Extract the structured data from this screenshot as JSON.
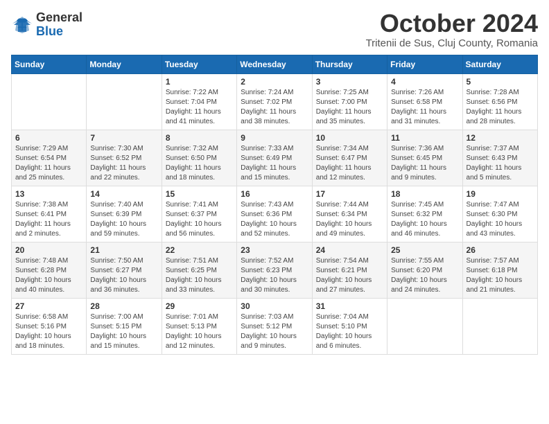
{
  "header": {
    "logo_general": "General",
    "logo_blue": "Blue",
    "month_title": "October 2024",
    "location": "Tritenii de Sus, Cluj County, Romania"
  },
  "days_of_week": [
    "Sunday",
    "Monday",
    "Tuesday",
    "Wednesday",
    "Thursday",
    "Friday",
    "Saturday"
  ],
  "weeks": [
    [
      {
        "day": "",
        "info": ""
      },
      {
        "day": "",
        "info": ""
      },
      {
        "day": "1",
        "info": "Sunrise: 7:22 AM\nSunset: 7:04 PM\nDaylight: 11 hours and 41 minutes."
      },
      {
        "day": "2",
        "info": "Sunrise: 7:24 AM\nSunset: 7:02 PM\nDaylight: 11 hours and 38 minutes."
      },
      {
        "day": "3",
        "info": "Sunrise: 7:25 AM\nSunset: 7:00 PM\nDaylight: 11 hours and 35 minutes."
      },
      {
        "day": "4",
        "info": "Sunrise: 7:26 AM\nSunset: 6:58 PM\nDaylight: 11 hours and 31 minutes."
      },
      {
        "day": "5",
        "info": "Sunrise: 7:28 AM\nSunset: 6:56 PM\nDaylight: 11 hours and 28 minutes."
      }
    ],
    [
      {
        "day": "6",
        "info": "Sunrise: 7:29 AM\nSunset: 6:54 PM\nDaylight: 11 hours and 25 minutes."
      },
      {
        "day": "7",
        "info": "Sunrise: 7:30 AM\nSunset: 6:52 PM\nDaylight: 11 hours and 22 minutes."
      },
      {
        "day": "8",
        "info": "Sunrise: 7:32 AM\nSunset: 6:50 PM\nDaylight: 11 hours and 18 minutes."
      },
      {
        "day": "9",
        "info": "Sunrise: 7:33 AM\nSunset: 6:49 PM\nDaylight: 11 hours and 15 minutes."
      },
      {
        "day": "10",
        "info": "Sunrise: 7:34 AM\nSunset: 6:47 PM\nDaylight: 11 hours and 12 minutes."
      },
      {
        "day": "11",
        "info": "Sunrise: 7:36 AM\nSunset: 6:45 PM\nDaylight: 11 hours and 9 minutes."
      },
      {
        "day": "12",
        "info": "Sunrise: 7:37 AM\nSunset: 6:43 PM\nDaylight: 11 hours and 5 minutes."
      }
    ],
    [
      {
        "day": "13",
        "info": "Sunrise: 7:38 AM\nSunset: 6:41 PM\nDaylight: 11 hours and 2 minutes."
      },
      {
        "day": "14",
        "info": "Sunrise: 7:40 AM\nSunset: 6:39 PM\nDaylight: 10 hours and 59 minutes."
      },
      {
        "day": "15",
        "info": "Sunrise: 7:41 AM\nSunset: 6:37 PM\nDaylight: 10 hours and 56 minutes."
      },
      {
        "day": "16",
        "info": "Sunrise: 7:43 AM\nSunset: 6:36 PM\nDaylight: 10 hours and 52 minutes."
      },
      {
        "day": "17",
        "info": "Sunrise: 7:44 AM\nSunset: 6:34 PM\nDaylight: 10 hours and 49 minutes."
      },
      {
        "day": "18",
        "info": "Sunrise: 7:45 AM\nSunset: 6:32 PM\nDaylight: 10 hours and 46 minutes."
      },
      {
        "day": "19",
        "info": "Sunrise: 7:47 AM\nSunset: 6:30 PM\nDaylight: 10 hours and 43 minutes."
      }
    ],
    [
      {
        "day": "20",
        "info": "Sunrise: 7:48 AM\nSunset: 6:28 PM\nDaylight: 10 hours and 40 minutes."
      },
      {
        "day": "21",
        "info": "Sunrise: 7:50 AM\nSunset: 6:27 PM\nDaylight: 10 hours and 36 minutes."
      },
      {
        "day": "22",
        "info": "Sunrise: 7:51 AM\nSunset: 6:25 PM\nDaylight: 10 hours and 33 minutes."
      },
      {
        "day": "23",
        "info": "Sunrise: 7:52 AM\nSunset: 6:23 PM\nDaylight: 10 hours and 30 minutes."
      },
      {
        "day": "24",
        "info": "Sunrise: 7:54 AM\nSunset: 6:21 PM\nDaylight: 10 hours and 27 minutes."
      },
      {
        "day": "25",
        "info": "Sunrise: 7:55 AM\nSunset: 6:20 PM\nDaylight: 10 hours and 24 minutes."
      },
      {
        "day": "26",
        "info": "Sunrise: 7:57 AM\nSunset: 6:18 PM\nDaylight: 10 hours and 21 minutes."
      }
    ],
    [
      {
        "day": "27",
        "info": "Sunrise: 6:58 AM\nSunset: 5:16 PM\nDaylight: 10 hours and 18 minutes."
      },
      {
        "day": "28",
        "info": "Sunrise: 7:00 AM\nSunset: 5:15 PM\nDaylight: 10 hours and 15 minutes."
      },
      {
        "day": "29",
        "info": "Sunrise: 7:01 AM\nSunset: 5:13 PM\nDaylight: 10 hours and 12 minutes."
      },
      {
        "day": "30",
        "info": "Sunrise: 7:03 AM\nSunset: 5:12 PM\nDaylight: 10 hours and 9 minutes."
      },
      {
        "day": "31",
        "info": "Sunrise: 7:04 AM\nSunset: 5:10 PM\nDaylight: 10 hours and 6 minutes."
      },
      {
        "day": "",
        "info": ""
      },
      {
        "day": "",
        "info": ""
      }
    ]
  ]
}
